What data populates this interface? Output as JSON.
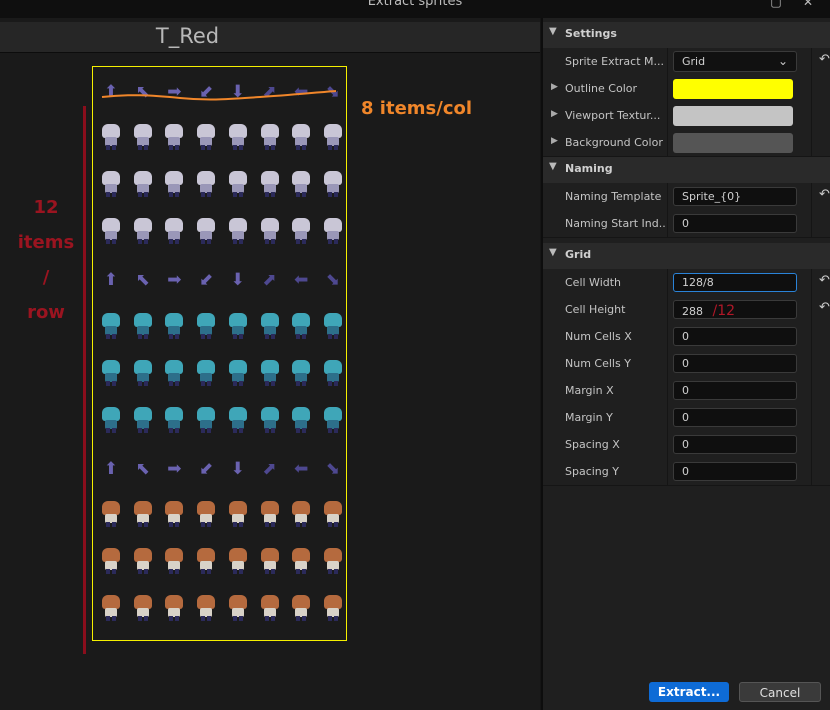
{
  "window": {
    "title": "Extract sprites"
  },
  "preview": {
    "texture_name": "T_Red",
    "annotations": {
      "cols_note": "8 items/col",
      "rows_note_lines": [
        "12",
        "items",
        "/",
        "row"
      ],
      "handwritten_note": "/12"
    },
    "sheet": {
      "columns": 8,
      "rows": 12,
      "row_kinds": [
        "arrow",
        "pale",
        "pale",
        "pale",
        "arrow",
        "teal",
        "teal",
        "teal",
        "arrow",
        "orange",
        "orange",
        "orange"
      ]
    }
  },
  "settings": {
    "section_label": "Settings",
    "sprite_extract_mode": {
      "label": "Sprite Extract M...",
      "value": "Grid"
    },
    "outline_color": {
      "label": "Outline Color",
      "color": "#ffff00"
    },
    "viewport_texture": {
      "label": "Viewport Textur...",
      "color": "#c4c4c4"
    },
    "background_color": {
      "label": "Background Color",
      "color": "#555555"
    }
  },
  "naming": {
    "section_label": "Naming",
    "naming_template": {
      "label": "Naming Template",
      "value": "Sprite_{0}"
    },
    "naming_start_index": {
      "label": "Naming Start Ind...",
      "value": "0"
    }
  },
  "grid": {
    "section_label": "Grid",
    "cell_width": {
      "label": "Cell Width",
      "value": "128/8"
    },
    "cell_height": {
      "label": "Cell Height",
      "value": "288"
    },
    "num_cells_x": {
      "label": "Num Cells X",
      "value": "0"
    },
    "num_cells_y": {
      "label": "Num Cells Y",
      "value": "0"
    },
    "margin_x": {
      "label": "Margin X",
      "value": "0"
    },
    "margin_y": {
      "label": "Margin Y",
      "value": "0"
    },
    "spacing_x": {
      "label": "Spacing X",
      "value": "0"
    },
    "spacing_y": {
      "label": "Spacing Y",
      "value": "0"
    }
  },
  "buttons": {
    "extract": "Extract...",
    "cancel": "Cancel"
  },
  "icons": {
    "reset": "reset-arrow-icon",
    "dropdown": "chevron-down-icon",
    "expand": "triangle-right-icon"
  },
  "colors": {
    "annotation_orange": "#f0862a",
    "annotation_red": "#9a1420",
    "sheet_border": "#f5f000",
    "primary_button": "#0e6bd6",
    "focus_border": "#2a83d8"
  }
}
